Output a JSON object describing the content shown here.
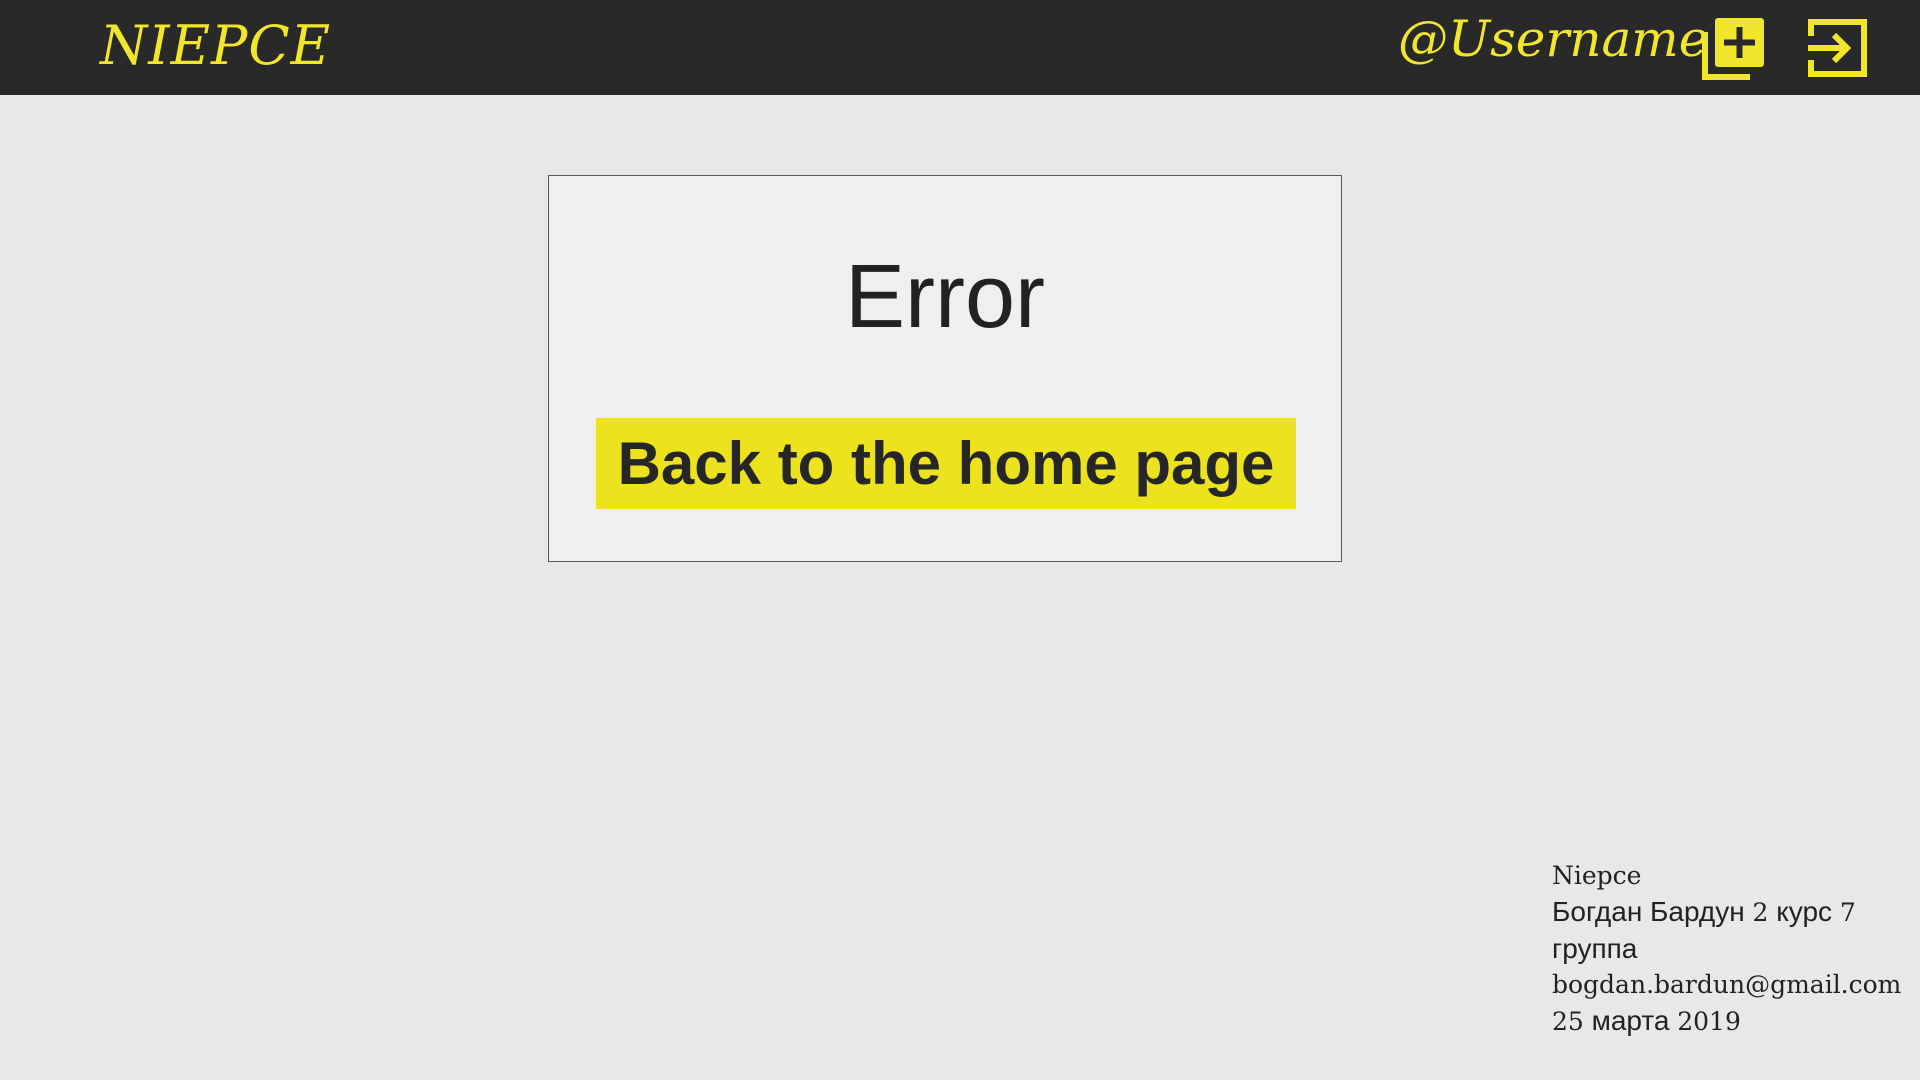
{
  "header": {
    "logo": "NIEPCE",
    "username": "@Username",
    "add_icon": "add-square-icon",
    "logout_icon": "logout-icon"
  },
  "error_card": {
    "title": "Error",
    "home_button_label": "Back to the home page"
  },
  "footer": {
    "site_name": "Niepce",
    "author_name": "Богдан Бардун",
    "course_number": "2",
    "course_label": "курс",
    "group_number": "7",
    "group_label": "группа",
    "email": "bogdan.bardun@gmail.com",
    "date_day": "25",
    "date_month": "марта",
    "date_year": "2019"
  },
  "colors": {
    "accent": "#ece31e",
    "topbar": "#2a292a",
    "background": "#e8e8e8",
    "card": "#efefef",
    "text": "#222222"
  }
}
